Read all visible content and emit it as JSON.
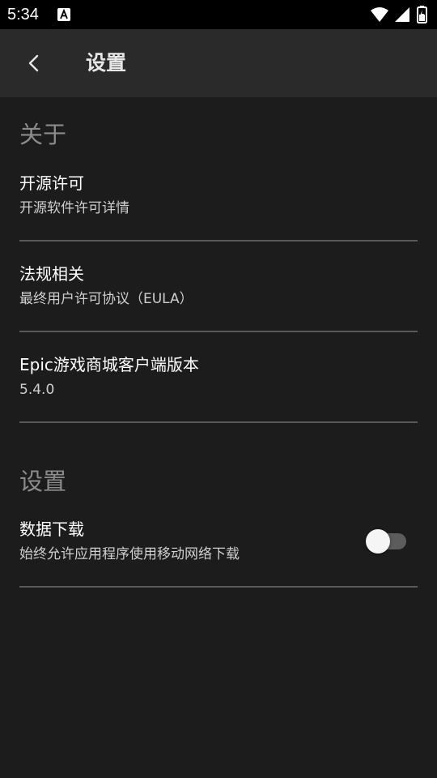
{
  "status_bar": {
    "time": "5:34",
    "notification_icon": "a-letter-icon",
    "icons": [
      "wifi-icon",
      "cellular-signal-icon",
      "battery-icon"
    ]
  },
  "app_bar": {
    "back_icon": "chevron-left-icon",
    "title": "设置"
  },
  "sections": {
    "about": {
      "header": "关于",
      "items": [
        {
          "title": "开源许可",
          "subtitle": "开源软件许可详情"
        },
        {
          "title": "法规相关",
          "subtitle": "最终用户许可协议（EULA）"
        },
        {
          "title": "Epic游戏商城客户端版本",
          "subtitle": "5.4.0"
        }
      ]
    },
    "settings": {
      "header": "设置",
      "items": [
        {
          "title": "数据下载",
          "subtitle": "始终允许应用程序使用移动网络下载",
          "toggle_on": false
        }
      ]
    }
  },
  "colors": {
    "background": "#1c1c1c",
    "app_bar": "#2a2a2a",
    "status_bar": "#000000",
    "section_header": "#8c8c8c",
    "divider": "#5a5a5a"
  }
}
